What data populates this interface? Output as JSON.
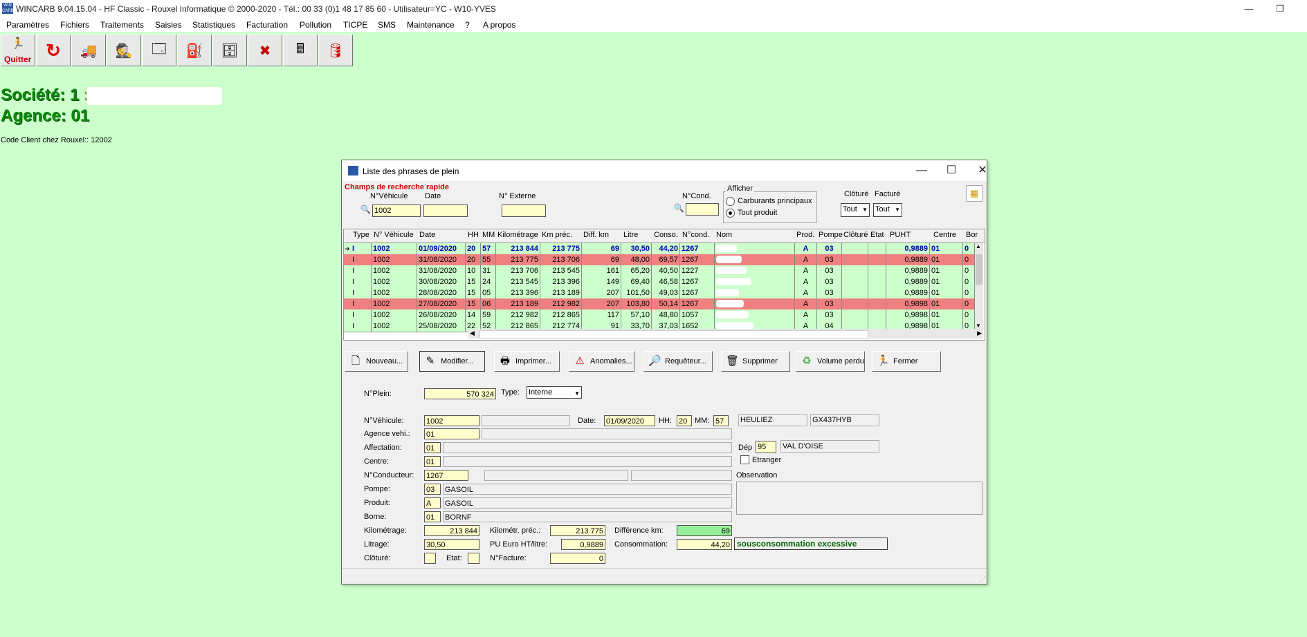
{
  "app": {
    "title": "WINCARB 9.04.15.04 - HF Classic - Rouxel Informatique © 2000-2020 - Tél.: 00 33 (0)1 48 17 85 60 - Utilisateur=YC - W10-YVES",
    "icon_label": "WIN CARB",
    "minimize_glyph": "—",
    "restore_glyph": "❐"
  },
  "menu": [
    "Paramètres",
    "Fichiers",
    "Traitements",
    "Saisies",
    "Statistiques",
    "Facturation",
    "Pollution",
    "TICPE",
    "SMS",
    "Maintenance",
    "?",
    "A propos"
  ],
  "toolbar": {
    "quit_label": "Quitter",
    "icons": [
      "quit-icon",
      "refresh-icon",
      "truck-icon",
      "driver-icon",
      "window-icon",
      "fuel-pump-icon",
      "archive-icon",
      "cancel-doc-icon",
      "calculator-icon",
      "barrel-icon"
    ]
  },
  "header": {
    "societe": "Société: 1 :",
    "agence": "Agence: 01",
    "code_client": "Code Client chez Rouxel:: 12002"
  },
  "dialog": {
    "title": "Liste des phrases de plein",
    "search": {
      "heading": "Champs de recherche rapide",
      "vehicule_label": "N°Véhicule",
      "vehicule_value": "1002",
      "date_label": "Date",
      "date_value": "",
      "externe_label": "N° Externe",
      "externe_value": "",
      "cond_label": "N°Cond.",
      "cond_value": "",
      "afficher_label": "Afficher",
      "afficher_options": [
        "Carburants principaux",
        "Tout produit"
      ],
      "afficher_selected": 1,
      "cloture_label": "Clôturé",
      "cloture_value": "Tout",
      "facture_label": "Facturé",
      "facture_value": "Tout"
    },
    "grid": {
      "headers": [
        "Type",
        "N° Véhicule",
        "Date",
        "HH",
        "MM",
        "Kilométrage",
        "Km préc.",
        "Diff. km",
        "Litre",
        "Conso.",
        "N°cond.",
        "Nom",
        "Prod.",
        "Pompe",
        "Clôturé",
        "Etat",
        "PUHT",
        "Centre",
        "Bor"
      ],
      "rows": [
        {
          "type": "I",
          "veh": "1002",
          "date": "01/09/2020",
          "hh": "20",
          "mm": "57",
          "km": "213 844",
          "kmp": "213 775",
          "diff": "69",
          "litre": "30,50",
          "conso": "44,20",
          "cond": "1267",
          "prod": "A",
          "pompe": "03",
          "puht": "0,9889",
          "centre": "01",
          "bor": "0",
          "style": "selected"
        },
        {
          "type": "I",
          "veh": "1002",
          "date": "31/08/2020",
          "hh": "20",
          "mm": "55",
          "km": "213 775",
          "kmp": "213 706",
          "diff": "69",
          "litre": "48,00",
          "conso": "69,57",
          "cond": "1267",
          "prod": "A",
          "pompe": "03",
          "puht": "0,9889",
          "centre": "01",
          "bor": "0",
          "style": "red"
        },
        {
          "type": "I",
          "veh": "1002",
          "date": "31/08/2020",
          "hh": "10",
          "mm": "31",
          "km": "213 706",
          "kmp": "213 545",
          "diff": "161",
          "litre": "65,20",
          "conso": "40,50",
          "cond": "1227",
          "prod": "A",
          "pompe": "03",
          "puht": "0,9889",
          "centre": "01",
          "bor": "0",
          "style": "green"
        },
        {
          "type": "I",
          "veh": "1002",
          "date": "30/08/2020",
          "hh": "15",
          "mm": "24",
          "km": "213 545",
          "kmp": "213 396",
          "diff": "149",
          "litre": "69,40",
          "conso": "46,58",
          "cond": "1267",
          "prod": "A",
          "pompe": "03",
          "puht": "0,9889",
          "centre": "01",
          "bor": "0",
          "style": "green"
        },
        {
          "type": "I",
          "veh": "1002",
          "date": "28/08/2020",
          "hh": "15",
          "mm": "05",
          "km": "213 396",
          "kmp": "213 189",
          "diff": "207",
          "litre": "101,50",
          "conso": "49,03",
          "cond": "1267",
          "prod": "A",
          "pompe": "03",
          "puht": "0,9889",
          "centre": "01",
          "bor": "0",
          "style": "green"
        },
        {
          "type": "I",
          "veh": "1002",
          "date": "27/08/2020",
          "hh": "15",
          "mm": "06",
          "km": "213 189",
          "kmp": "212 982",
          "diff": "207",
          "litre": "103,80",
          "conso": "50,14",
          "cond": "1267",
          "prod": "A",
          "pompe": "03",
          "puht": "0,9898",
          "centre": "01",
          "bor": "0",
          "style": "red"
        },
        {
          "type": "I",
          "veh": "1002",
          "date": "26/08/2020",
          "hh": "14",
          "mm": "59",
          "km": "212 982",
          "kmp": "212 865",
          "diff": "117",
          "litre": "57,10",
          "conso": "48,80",
          "cond": "1057",
          "prod": "A",
          "pompe": "03",
          "puht": "0,9898",
          "centre": "01",
          "bor": "0",
          "style": "green"
        },
        {
          "type": "I",
          "veh": "1002",
          "date": "25/08/2020",
          "hh": "22",
          "mm": "52",
          "km": "212 865",
          "kmp": "212 774",
          "diff": "91",
          "litre": "33,70",
          "conso": "37,03",
          "cond": "1652",
          "prod": "A",
          "pompe": "04",
          "puht": "0,9898",
          "centre": "01",
          "bor": "0",
          "style": "green"
        }
      ]
    },
    "buttons": {
      "nouveau": "Nouveau...",
      "modifier": "Modifier...",
      "imprimer": "Imprimer...",
      "anomalies": "Anomalies...",
      "requeteur": "Requêteur...",
      "supprimer": "Supprimer",
      "volume_perdu": "Volume perdu",
      "fermer": "Fermer"
    },
    "detail": {
      "nplein_label": "N°Plein:",
      "nplein_value": "570 324",
      "type_label": "Type:",
      "type_value": "Interne",
      "vehicule_label": "N°Véhicule:",
      "vehicule_value": "1002",
      "date_label": "Date:",
      "date_value": "01/09/2020",
      "hh_label": "HH:",
      "hh_value": "20",
      "mm_label": "MM:",
      "mm_value": "57",
      "marque": "HEULIEZ",
      "immat": "GX437HYB",
      "agence_label": "Agence vehi.:",
      "agence_value": "01",
      "affectation_label": "Affectation:",
      "affectation_value": "01",
      "dep_label": "Dép",
      "dep_value": "95",
      "dep_name": "VAL D'OISE",
      "centre_label": "Centre:",
      "centre_value": "01",
      "etranger_label": "Etranger",
      "conducteur_label": "N°Conducteur:",
      "conducteur_value": "1267",
      "observation_label": "Observation",
      "pompe_label": "Pompe:",
      "pompe_value": "03",
      "pompe_name": "GASOIL",
      "produit_label": "Produit:",
      "produit_value": "A",
      "produit_name": "GASOIL",
      "borne_label": "Borne:",
      "borne_value": "01",
      "borne_name": "BORNF",
      "km_label": "Kilométrage:",
      "km_value": "213 844",
      "kmprec_label": "Kilométr. préc.:",
      "kmprec_value": "213 775",
      "diffkm_label": "Différence km:",
      "diffkm_value": "69",
      "litrage_label": "Litrage:",
      "litrage_value": "30,50",
      "pu_label": "PU Euro HT/litre:",
      "pu_value": "0,9889",
      "conso_label": "Consommation:",
      "conso_value": "44,20",
      "conso_status": "sousconsommation excessive",
      "cloture_label": "Clôturé:",
      "etat_label": "Etat:",
      "facture_label": "N°Facture:",
      "facture_value": "0"
    }
  },
  "colors": {
    "background": "#ccffcc",
    "row_green": "#ccffcc",
    "row_red": "#f08080",
    "accent_red": "#cc0000",
    "conso_status": "#006400"
  }
}
